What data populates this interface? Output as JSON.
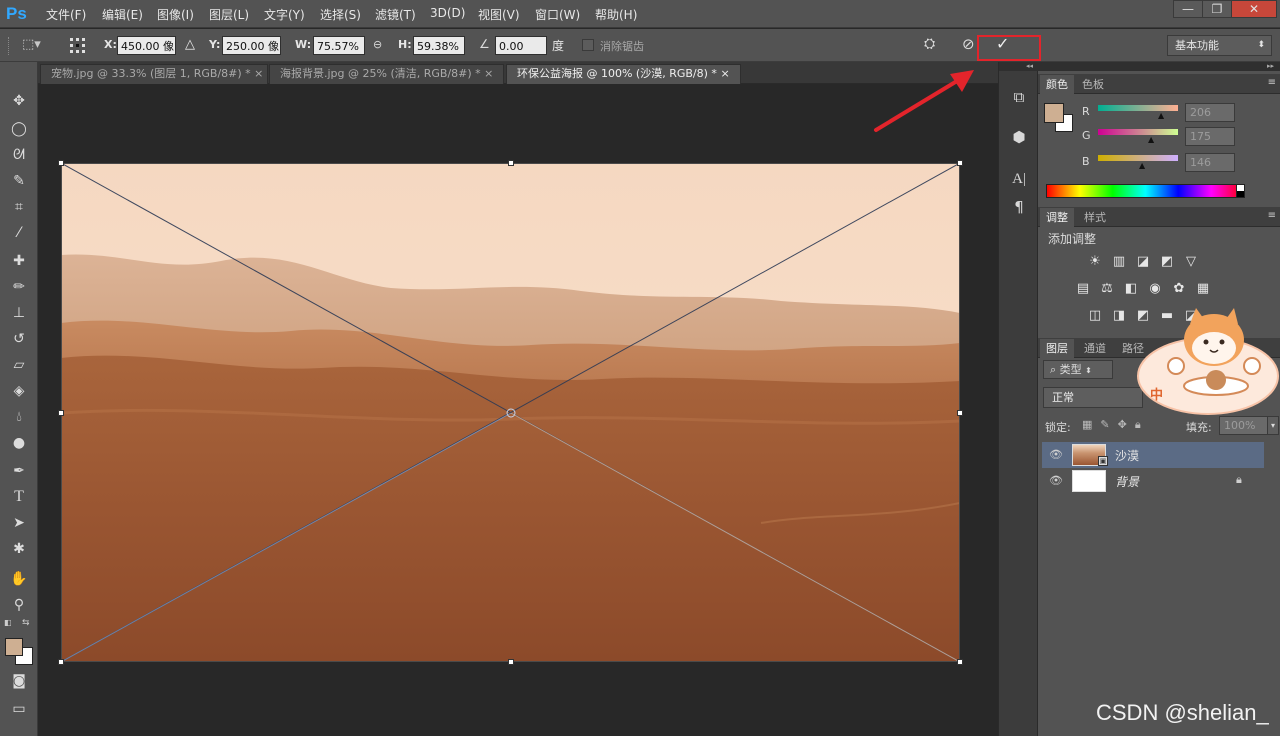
{
  "app": {
    "logo": "Ps"
  },
  "menu": [
    "文件(F)",
    "编辑(E)",
    "图像(I)",
    "图层(L)",
    "文字(Y)",
    "选择(S)",
    "滤镜(T)",
    "3D(D)",
    "视图(V)",
    "窗口(W)",
    "帮助(H)"
  ],
  "window_controls": {
    "minimize": "—",
    "restore": "❐",
    "close": "✕"
  },
  "options": {
    "x_label": "X:",
    "x_value": "450.00 像",
    "delta_icon": "△",
    "y_label": "Y:",
    "y_value": "250.00 像",
    "w_label": "W:",
    "w_value": "75.57%",
    "h_label": "H:",
    "h_value": "59.38%",
    "angle_value": "0.00",
    "angle_unit": "度",
    "antialias_label": "消除锯齿",
    "workspace": "基本功能"
  },
  "tabs": [
    {
      "label": "宠物.jpg @ 33.3% (图层 1, RGB/8#) *",
      "close": "×"
    },
    {
      "label": "海报背景.jpg @ 25% (清洁, RGB/8#) *",
      "close": "×"
    },
    {
      "label": "环保公益海报 @ 100% (沙漠, RGB/8) *",
      "close": "×"
    }
  ],
  "color_panel": {
    "tabs": [
      "颜色",
      "色板"
    ],
    "channels": [
      {
        "label": "R",
        "value": "206"
      },
      {
        "label": "G",
        "value": "175"
      },
      {
        "label": "B",
        "value": "146"
      }
    ],
    "foreground": "#ceaf92"
  },
  "adjust_panel": {
    "tabs": [
      "调整",
      "样式"
    ],
    "title": "添加调整"
  },
  "layers_panel": {
    "tabs": [
      "图层",
      "通道",
      "路径"
    ],
    "filter": "类型",
    "blend_mode": "正常",
    "lock_label": "锁定:",
    "fill_label": "填充:",
    "fill_value": "100%",
    "layers": [
      {
        "name": "沙漠",
        "selected": true
      },
      {
        "name": "背景",
        "selected": false
      }
    ]
  },
  "watermark": "CSDN @shelian_",
  "sticker": {
    "text": "中"
  },
  "colors": {
    "accent": "#e3242b",
    "ps_blue": "#31a8ff",
    "ui_gray": "#535353"
  }
}
